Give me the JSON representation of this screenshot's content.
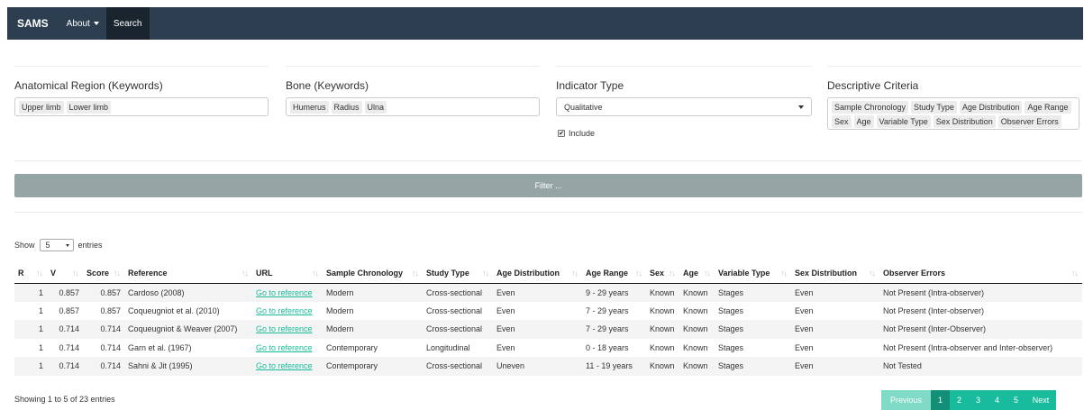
{
  "navbar": {
    "brand": "SAMS",
    "items": [
      {
        "label": "About",
        "dropdown": true,
        "active": false
      },
      {
        "label": "Search",
        "dropdown": false,
        "active": true
      }
    ]
  },
  "filters": {
    "anatomical_region": {
      "label": "Anatomical Region (Keywords)",
      "tags": [
        "Upper limb",
        "Lower limb"
      ]
    },
    "bone": {
      "label": "Bone (Keywords)",
      "tags": [
        "Humerus",
        "Radius",
        "Ulna"
      ]
    },
    "indicator_type": {
      "label": "Indicator Type",
      "selected": "Qualitative",
      "include_label": "Include",
      "include_checked": true
    },
    "descriptive_criteria": {
      "label": "Descriptive Criteria",
      "tags": [
        "Sample Chronology",
        "Study Type",
        "Age Distribution",
        "Age Range",
        "Sex",
        "Age",
        "Variable Type",
        "Sex Distribution",
        "Observer Errors"
      ]
    },
    "filter_button": "Filter ..."
  },
  "length_menu": {
    "show_label": "Show",
    "value": "5",
    "entries_label": "entries"
  },
  "table": {
    "columns": [
      "R",
      "V",
      "Score",
      "Reference",
      "URL",
      "Sample Chronology",
      "Study Type",
      "Age Distribution",
      "Age Range",
      "Sex",
      "Age",
      "Variable Type",
      "Sex Distribution",
      "Observer Errors"
    ],
    "rows": [
      {
        "r": "1",
        "v": "0.857",
        "score": "0.857",
        "reference": "Cardoso (2008)",
        "url": "Go to reference",
        "sample_chronology": "Modern",
        "study_type": "Cross-sectional",
        "age_distribution": "Even",
        "age_range": "9 - 29 years",
        "sex": "Known",
        "age": "Known",
        "variable_type": "Stages",
        "sex_distribution": "Even",
        "observer_errors": "Not Present (Intra-observer)"
      },
      {
        "r": "1",
        "v": "0.857",
        "score": "0.857",
        "reference": "Coqueugniot et al. (2010)",
        "url": "Go to reference",
        "sample_chronology": "Modern",
        "study_type": "Cross-sectional",
        "age_distribution": "Even",
        "age_range": "7 - 29 years",
        "sex": "Known",
        "age": "Known",
        "variable_type": "Stages",
        "sex_distribution": "Even",
        "observer_errors": "Not Present (Inter-observer)"
      },
      {
        "r": "1",
        "v": "0.714",
        "score": "0.714",
        "reference": "Coqueugniot & Weaver (2007)",
        "url": "Go to reference",
        "sample_chronology": "Modern",
        "study_type": "Cross-sectional",
        "age_distribution": "Even",
        "age_range": "7 - 29 years",
        "sex": "Known",
        "age": "Known",
        "variable_type": "Stages",
        "sex_distribution": "Even",
        "observer_errors": "Not Present (Inter-Observer)"
      },
      {
        "r": "1",
        "v": "0.714",
        "score": "0.714",
        "reference": "Garn et al. (1967)",
        "url": "Go to reference",
        "sample_chronology": "Contemporary",
        "study_type": "Longitudinal",
        "age_distribution": "Even",
        "age_range": "0 - 18 years",
        "sex": "Known",
        "age": "Known",
        "variable_type": "Stages",
        "sex_distribution": "Even",
        "observer_errors": "Not Present (Intra-observer and Inter-observer)"
      },
      {
        "r": "1",
        "v": "0.714",
        "score": "0.714",
        "reference": "Sahni & Jit (1995)",
        "url": "Go to reference",
        "sample_chronology": "Contemporary",
        "study_type": "Cross-sectional",
        "age_distribution": "Uneven",
        "age_range": "11 - 19 years",
        "sex": "Known",
        "age": "Known",
        "variable_type": "Stages",
        "sex_distribution": "Even",
        "observer_errors": "Not Tested"
      }
    ],
    "info": "Showing 1 to 5 of 23 entries"
  },
  "pagination": {
    "previous": "Previous",
    "pages": [
      "1",
      "2",
      "3",
      "4",
      "5"
    ],
    "current": "1",
    "next": "Next"
  },
  "colors": {
    "navbar": "#2c3e50",
    "accent": "#18bc9c",
    "filter_button": "#95a5a6"
  }
}
